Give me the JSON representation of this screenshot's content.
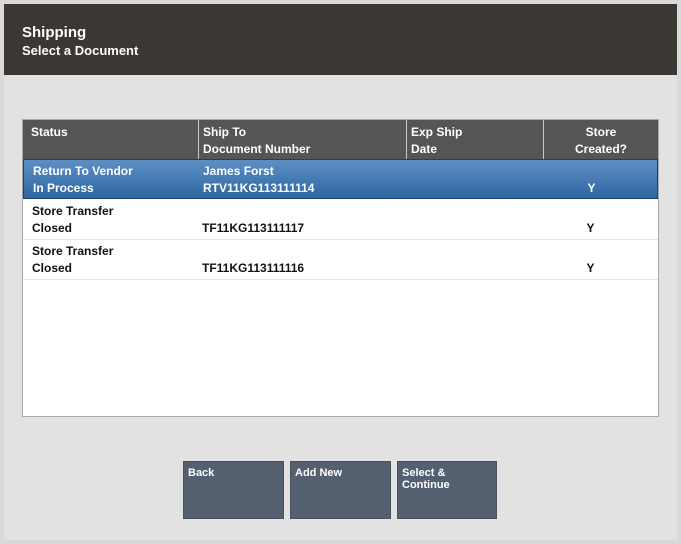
{
  "header": {
    "title": "Shipping",
    "subtitle": "Select a Document"
  },
  "table": {
    "columns": [
      {
        "line1": "Status",
        "line2": ""
      },
      {
        "line1": "Ship To",
        "line2": "Document Number"
      },
      {
        "line1": "Exp Ship",
        "line2": "Date"
      },
      {
        "line1": "Store",
        "line2": "Created?"
      }
    ],
    "rows": [
      {
        "status": "Return To Vendor",
        "state": "In Process",
        "ship_to": "James Forst",
        "doc_number": "RTV11KG113111114",
        "exp_ship_date": "",
        "store_created": "Y"
      },
      {
        "status": "Store Transfer",
        "state": "Closed",
        "ship_to": "",
        "doc_number": "TF11KG113111117",
        "exp_ship_date": "",
        "store_created": "Y"
      },
      {
        "status": "Store Transfer",
        "state": "Closed",
        "ship_to": "",
        "doc_number": "TF11KG113111116",
        "exp_ship_date": "",
        "store_created": "Y"
      }
    ]
  },
  "buttons": {
    "back": {
      "line1": "Back",
      "line2": ""
    },
    "add_new": {
      "line1": "Add New",
      "line2": ""
    },
    "select_continue": {
      "line1": "Select &",
      "line2": "Continue"
    }
  },
  "colors": {
    "header_bg": "#3b3733",
    "table_header_bg": "#555555",
    "selected_row": "#2e66a3",
    "button_bg": "#546070"
  }
}
